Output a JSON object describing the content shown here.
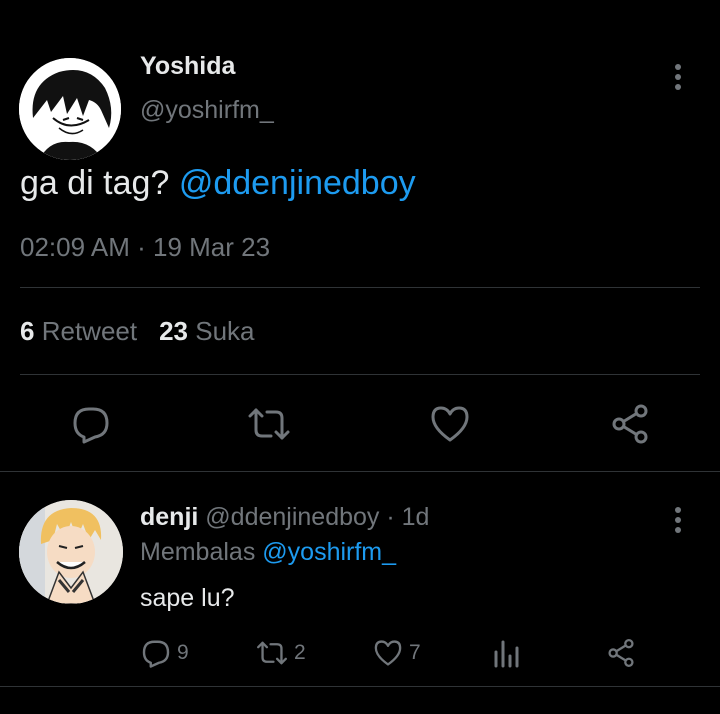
{
  "tweet": {
    "author_name": "Yoshida",
    "author_handle": "@yoshirfm_",
    "text": "ga di tag?",
    "mention": "@ddenjinedboy",
    "time": "02:09 AM",
    "separator": "·",
    "date": "19 Mar 23",
    "retweet_count": "6",
    "retweet_label": "Retweet",
    "like_count": "23",
    "like_label": "Suka"
  },
  "reply": {
    "author_name": "denji",
    "author_handle": "@ddenjinedboy",
    "separator": "·",
    "age": "1d",
    "replying_label": "Membalas",
    "replying_handle": "@yoshirfm_",
    "text": "sape lu?",
    "reply_count": "9",
    "retweet_count": "2",
    "like_count": "7"
  },
  "colors": {
    "background": "#000000",
    "text": "#e7e9ea",
    "muted": "#71767b",
    "link": "#1d9bf0",
    "divider": "#2f3336"
  },
  "icons": [
    "more-icon",
    "reply-icon",
    "retweet-icon",
    "like-icon",
    "share-icon",
    "analytics-icon"
  ]
}
